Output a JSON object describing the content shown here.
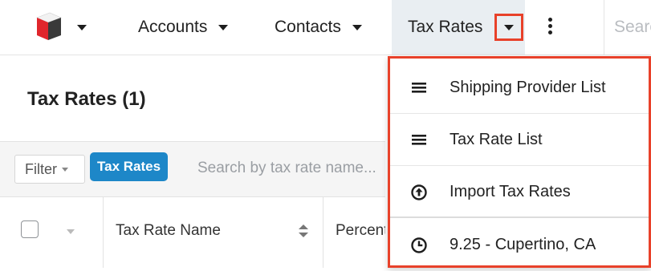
{
  "nav": {
    "logo_icon": "sugar-cube-logo-icon",
    "items": [
      {
        "label": "Accounts"
      },
      {
        "label": "Contacts"
      },
      {
        "label": "Tax Rates"
      }
    ],
    "search_placeholder": "Search"
  },
  "list": {
    "title": "Tax Rates (1)",
    "filter_label": "Filter",
    "filter_pill": "Tax Rates",
    "search_placeholder": "Search by tax rate name...",
    "columns": [
      "Tax Rate Name",
      "Percentage"
    ]
  },
  "dropdown": {
    "items": [
      {
        "label": "Shipping Provider List",
        "icon": "list-icon"
      },
      {
        "label": "Tax Rate List",
        "icon": "list-icon"
      },
      {
        "label": "Import Tax Rates",
        "icon": "upload-circle-icon"
      }
    ],
    "recent": [
      {
        "label": "9.25 - Cupertino, CA",
        "icon": "clock-icon"
      }
    ]
  },
  "colors": {
    "highlight": "#e8412a",
    "pill": "#1d87c8",
    "active_tab": "#e9eef2"
  }
}
